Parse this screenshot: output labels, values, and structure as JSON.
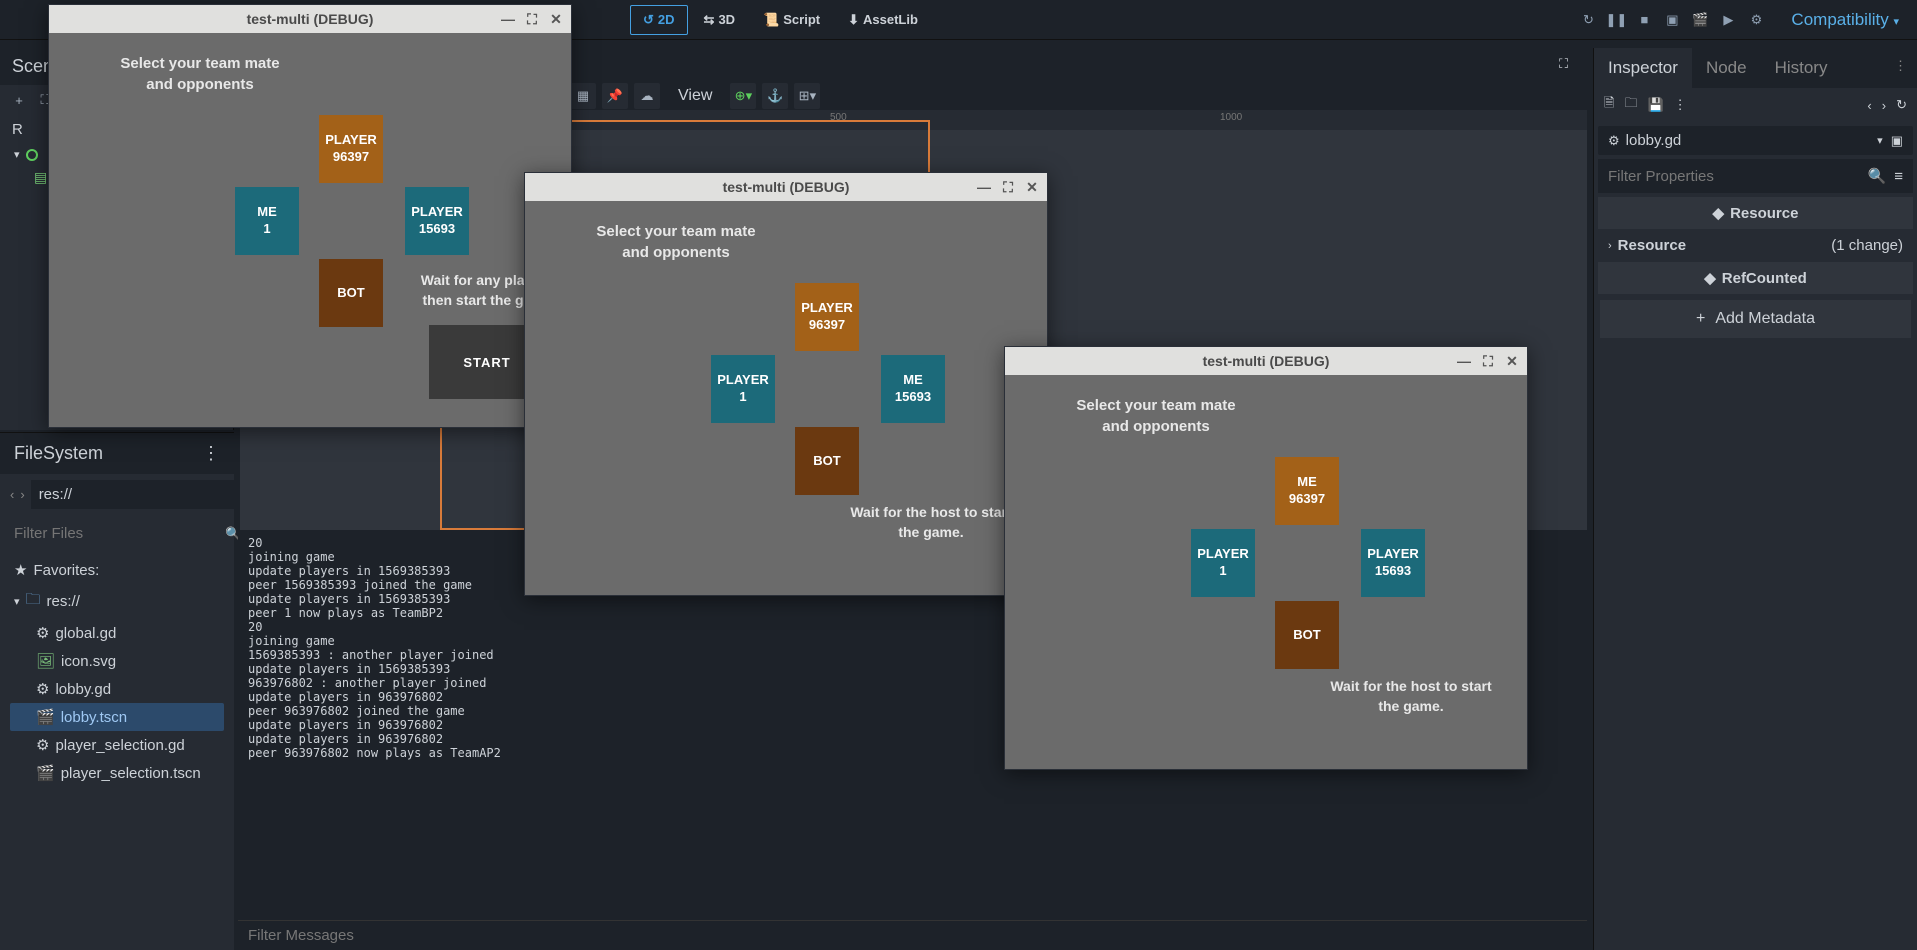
{
  "topbar": {
    "modes": {
      "d2": "2D",
      "d3": "3D",
      "script": "Script",
      "assetlib": "AssetLib"
    },
    "renderer": "Compatibility"
  },
  "scene_dock": {
    "title": "Scene",
    "root_prefix": "R"
  },
  "filesystem": {
    "title": "FileSystem",
    "path_value": "res://",
    "filter_placeholder": "Filter Files",
    "favorites": "Favorites:",
    "root": "res://",
    "items": [
      {
        "name": "global.gd",
        "icon": "gear"
      },
      {
        "name": "icon.svg",
        "icon": "img"
      },
      {
        "name": "lobby.gd",
        "icon": "gear"
      },
      {
        "name": "lobby.tscn",
        "icon": "scene",
        "selected": true
      },
      {
        "name": "player_selection.gd",
        "icon": "gear"
      },
      {
        "name": "player_selection.tscn",
        "icon": "scene"
      }
    ]
  },
  "viewport": {
    "view_label": "View",
    "ruler_ticks": [
      "500",
      "1000"
    ]
  },
  "output": {
    "lines": "20\njoining game\nupdate players in 1569385393\npeer 1569385393 joined the game\nupdate players in 1569385393\npeer 1 now plays as TeamBP2\n20\njoining game\n1569385393 : another player joined\nupdate players in 1569385393\n963976802 : another player joined\nupdate players in 963976802\npeer 963976802 joined the game\nupdate players in 963976802\nupdate players in 963976802\npeer 963976802 now plays as TeamAP2",
    "filter_placeholder": "Filter Messages"
  },
  "inspector": {
    "tabs": {
      "inspector": "Inspector",
      "node": "Node",
      "history": "History"
    },
    "script": "lobby.gd",
    "filter_placeholder": "Filter Properties",
    "cat_resource": "Resource",
    "row_resource": "Resource",
    "row_resource_change": "(1 change)",
    "cat_refcounted": "RefCounted",
    "add_metadata": "Add Metadata"
  },
  "game_windows": {
    "common": {
      "title": "test-multi (DEBUG)",
      "prompt": "Select your team mate\nand opponents",
      "wait_host": "Wait for the host to\nstart the game.",
      "wait_any": "Wait for any players,\nthen start the game.",
      "start": "START",
      "bot": "BOT",
      "me": "ME"
    },
    "w1": {
      "top": {
        "l1": "PLAYER",
        "l2": "96397"
      },
      "left": {
        "l1": "ME",
        "l2": "1"
      },
      "right": {
        "l1": "PLAYER",
        "l2": "15693"
      }
    },
    "w2": {
      "top": {
        "l1": "PLAYER",
        "l2": "96397"
      },
      "left": {
        "l1": "PLAYER",
        "l2": "1"
      },
      "right": {
        "l1": "ME",
        "l2": "15693"
      }
    },
    "w3": {
      "top": {
        "l1": "ME",
        "l2": "96397"
      },
      "left": {
        "l1": "PLAYER",
        "l2": "1"
      },
      "right": {
        "l1": "PLAYER",
        "l2": "15693"
      }
    }
  }
}
